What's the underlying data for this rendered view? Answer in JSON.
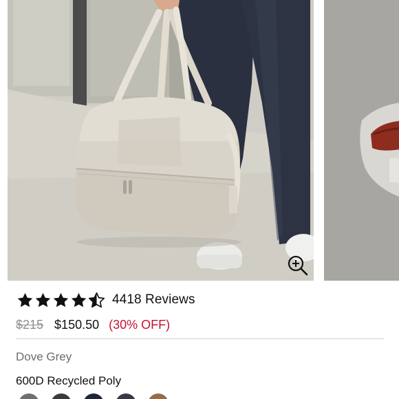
{
  "product": {
    "rating": 4.5,
    "review_count_text": "4418 Reviews",
    "price_original": "$215",
    "price_sale": "$150.50",
    "discount_label": "(30% OFF)",
    "color_name": "Dove Grey",
    "material": "600D Recycled Poly"
  },
  "icons": {
    "zoom": "zoom-in-icon",
    "star_full": "star-icon",
    "star_half": "half-star-icon"
  },
  "swatches": [
    {
      "name": "swatch-grey",
      "color": "#6f6f6c"
    },
    {
      "name": "swatch-charcoal",
      "color": "#3a3a3c"
    },
    {
      "name": "swatch-navy",
      "color": "#1f2638"
    },
    {
      "name": "swatch-slate",
      "color": "#363a45"
    },
    {
      "name": "swatch-brown",
      "color": "#9a6a45"
    }
  ],
  "colors": {
    "accent_sale": "#c8102e",
    "text_muted": "#8d8d8d"
  }
}
